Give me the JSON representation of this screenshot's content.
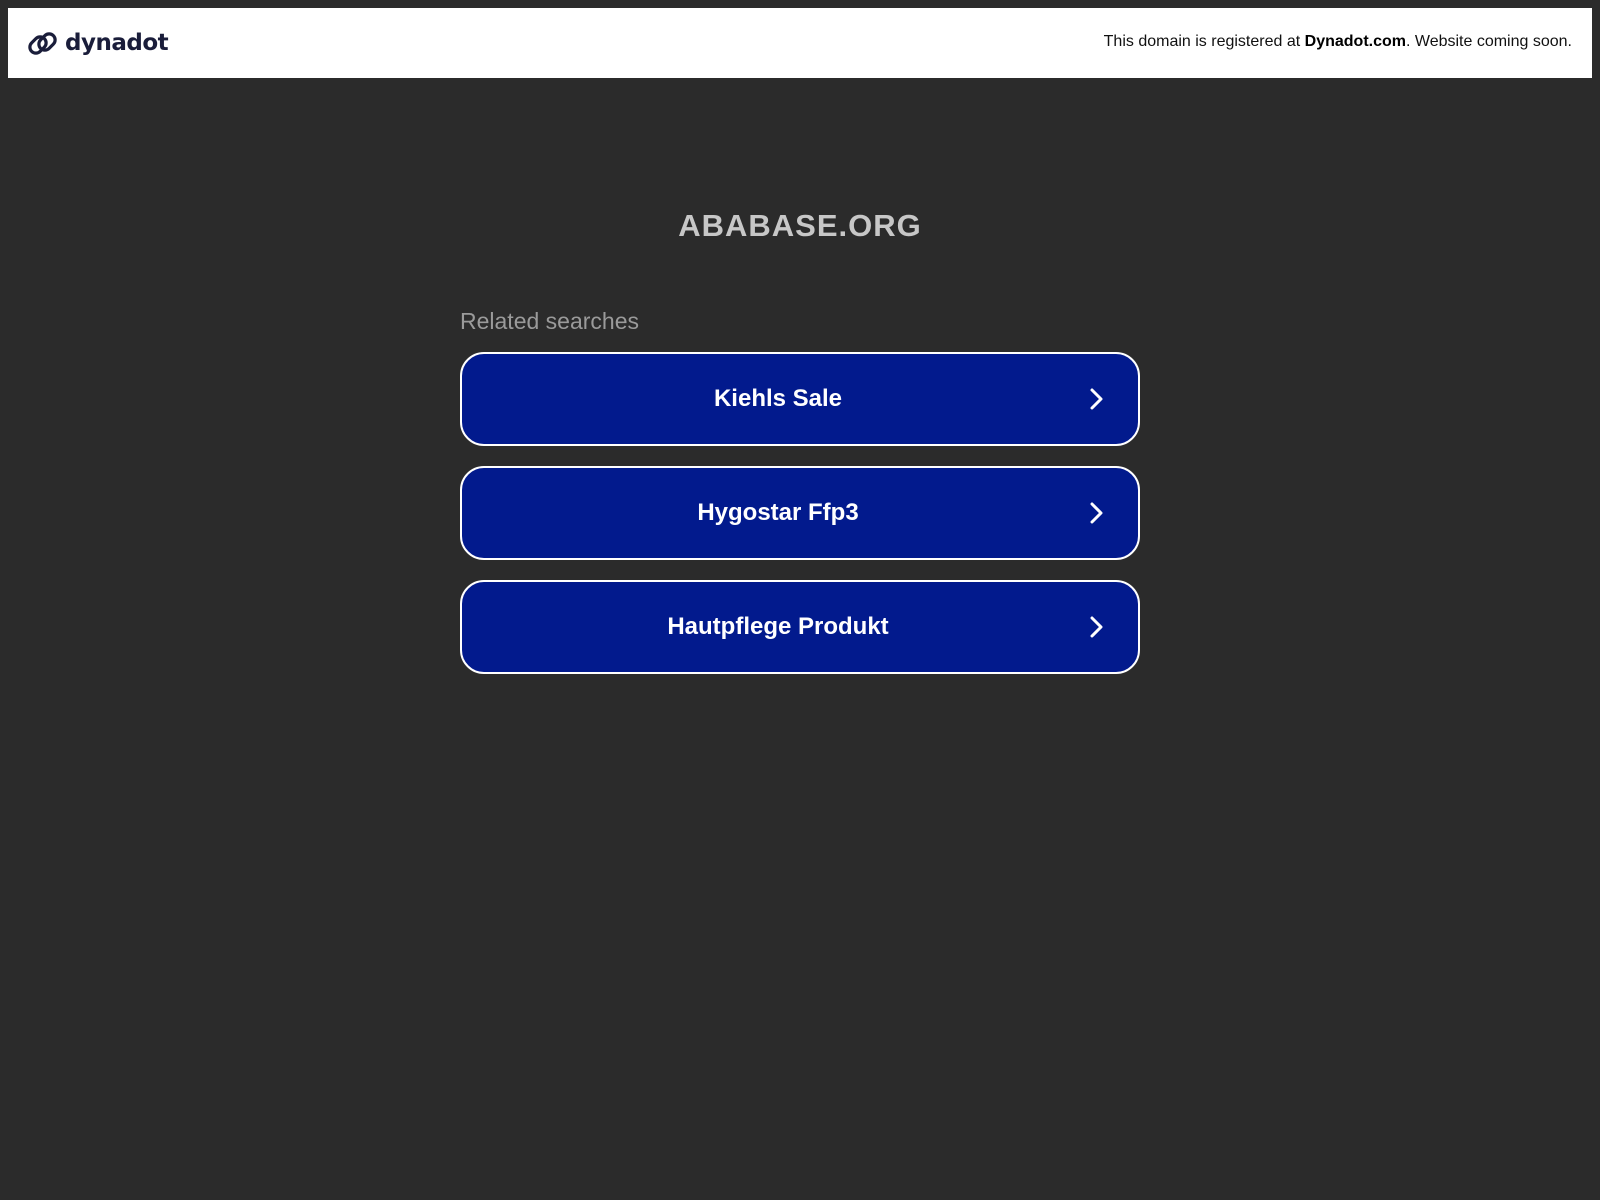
{
  "header": {
    "logo_text": "dynadot",
    "logo_icon": "link-icon",
    "notice_prefix": "This domain is registered at ",
    "notice_brand": "Dynadot.com",
    "notice_suffix": ". Website coming soon."
  },
  "main": {
    "domain": "ABABASE.ORG",
    "related_label": "Related searches",
    "results": [
      {
        "label": "Kiehls Sale",
        "icon": "chevron-right-icon"
      },
      {
        "label": "Hygostar Ffp3",
        "icon": "chevron-right-icon"
      },
      {
        "label": "Hautpflege Produkt",
        "icon": "chevron-right-icon"
      }
    ]
  },
  "colors": {
    "background": "#2b2b2b",
    "header_bg": "#ffffff",
    "button_bg": "#021a8d",
    "button_border": "#ffffff",
    "domain_text": "#c7c7c7",
    "related_text": "#9a9a9a",
    "logo_text": "#1a1d3a"
  }
}
